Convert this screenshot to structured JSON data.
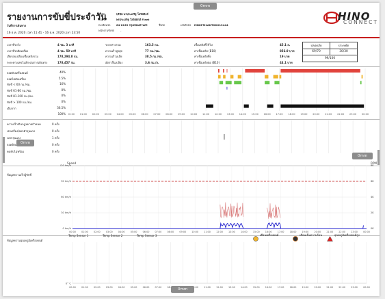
{
  "header": {
    "title": "รายงานการขับขี่ประจำวัน",
    "date_label": "วันที่การเดินทาง",
    "period": "16 ธ.ค. 2020 เวลา 11:41 - 16 ธ.ค. 2020 เวลา 23:50",
    "tag": "0mm",
    "company_label": "บริษัท",
    "company": "บริษัท พรประเสริฐ โลจิสติกส์",
    "group_label": "กลุ่มรถ",
    "group": "พรประเสริฐ โลจิสติกส์ Fleet",
    "plate_label": "ทะเบียนรถ",
    "plate": "64-8139 กรุงเทพมหานคร",
    "code_label": "ชื่อรถ",
    "vin_label": "เลขตัวถัง",
    "vin": "MNKFM1ANTXKX13444",
    "driver_label": "พนักงานขับรถ",
    "driver": "-",
    "logo_main": "HINO",
    "logo_sub": "CONNECT"
  },
  "summary": {
    "rows": [
      {
        "l1": "เวลาที่รถวิ่ง",
        "v1": "4 ชม. 3 นาที",
        "l2": "ระยะทางรวม",
        "v2": "163.5 กม.",
        "l3": "เชื้อเพลิงที่ใช้ไป",
        "v3": "45.1 ล."
      },
      {
        "l1": "เวลาที่รถติดเครื่อง",
        "v1": "4 ชม. 50 นาที",
        "l2": "ความเร็วสูงสุด",
        "v2": "77 กม./ชม.",
        "l3": "ค่าเชื้อเพลิง (B10)",
        "v3": "856.9 บาท"
      },
      {
        "l1": "เสียรอบเปลืองเชื้อเพลิงรวม",
        "v1": "178,294.8 กม.",
        "l2": "ความเร็วเฉลี่ย",
        "v2": "38.5 กม./ชม.",
        "l3": "ค่าเชื้อเพลิงทิ้ง",
        "v3": "19 บาท"
      },
      {
        "l1": "ระยะทางเลขไมล์สะสมการเดินทาง",
        "v1": "178,457 กม.",
        "l2": "อัตราสิ้นเปลือง",
        "v2": "3.6 กม./ล.",
        "l3": "ค่าเชื้อเพลิงต่อ (B10)",
        "v3": "44.1 บาท"
      }
    ],
    "score_table": {
      "headers": [
        "ปลอดภัย",
        "ประหยัด"
      ],
      "values": [
        "69/70",
        "30/30"
      ],
      "total": "99/100"
    }
  },
  "timeline": {
    "rows": [
      {
        "label": "จอดดับเครื่องยนต์",
        "pct": "40%"
      },
      {
        "label": "จอดไม่ดับเครื่อง",
        "pct": "5.5%"
      },
      {
        "label": "ขับขี่ < 60 กม./ชม.",
        "pct": "16%"
      },
      {
        "label": "ขับขี่ 61-80 กม./ชม.",
        "pct": "0%"
      },
      {
        "label": "ขับขี่ 81-100 กม./ชม.",
        "pct": "0%"
      },
      {
        "label": "ขับขี่ > 100 กม./ชม.",
        "pct": "0%"
      },
      {
        "label": "เติมจาก",
        "pct": "36.5%"
      }
    ],
    "total_pct": "100%",
    "hours": [
      "00:00",
      "01:00",
      "02:00",
      "03:00",
      "04:00",
      "05:00",
      "06:00",
      "07:00",
      "08:00",
      "09:00",
      "10:00",
      "11:00",
      "12:00",
      "13:00",
      "14:00",
      "15:00",
      "16:00",
      "17:00",
      "18:00",
      "19:00",
      "20:00",
      "21:00",
      "22:00",
      "23:00",
      "00:00"
    ]
  },
  "events": {
    "rows": [
      {
        "label": "ความเร็วเกินกฎหมายกำหนด",
        "count": "0 ครั้ง"
      },
      {
        "label": "เร่งเครื่อง/ออกตัวรุนแรง",
        "count": "0 ครั้ง"
      },
      {
        "label": "เบรกรุนแรง",
        "count": "1 ครั้ง"
      },
      {
        "label": "จอดติดเครื่อง",
        "count": "0 ครั้ง"
      },
      {
        "label": "คนขับไม่พร้อม",
        "count": "0 ครั้ง"
      }
    ]
  },
  "speed_chart": {
    "label": "ข้อมูลความเร็วผู้ขับขี่",
    "left_axis_title": "Speed",
    "right_axis_title": "RPM",
    "left_ticks": [
      "120 km/h",
      "90 km/h",
      "60 km/h",
      "30 km/h",
      "0 km/h"
    ],
    "right_ticks": [
      "8K",
      "6K",
      "4K",
      "2K",
      "0K"
    ]
  },
  "temp_chart": {
    "label": "ข้อมูลความอุณหภูมิเครื่องยนต์",
    "sensors": [
      "Temp Sensor 1",
      "Temp Sensor 2",
      "Temp Sensor 3"
    ],
    "legend": [
      "เตือนเครื่องยนต์",
      "เตือนเข็มความร้อน",
      "อุณหภูมิเครื่องยนต์สูง"
    ],
    "zero_tick": "0° C"
  },
  "overlays": {
    "left_tag": "0mm",
    "right_tag": "0mm",
    "bottom_tag": "0mm",
    "left_vertical_text": "0mm"
  },
  "colors": {
    "accent_red": "#c81e1e",
    "parked": "#e1433c",
    "idle": "#f0b42d",
    "driving": "#68c84c",
    "speed_line": "#1c1ccc",
    "rpm_line": "#e2a0a0",
    "threshold": "#c81e1e"
  },
  "chart_data": [
    {
      "type": "line",
      "title": "",
      "xlabel": "",
      "ylabel": "Speed",
      "y2label": "RPM",
      "x": [
        "12:00",
        "12:30",
        "13:00",
        "13:30",
        "14:00",
        "14:30",
        "15:00",
        "15:30",
        "16:00",
        "16:30",
        "17:00",
        "17:30"
      ],
      "series": [
        {
          "name": "Speed",
          "values": [
            0,
            35,
            30,
            5,
            0,
            0,
            0,
            28,
            30,
            2,
            0,
            0
          ]
        },
        {
          "name": "RPM",
          "values": [
            0,
            2200,
            2100,
            400,
            0,
            0,
            0,
            2300,
            2200,
            300,
            0,
            0
          ]
        }
      ],
      "ylim": [
        0,
        120
      ],
      "y2lim": [
        0,
        8000
      ],
      "threshold": 90
    }
  ]
}
